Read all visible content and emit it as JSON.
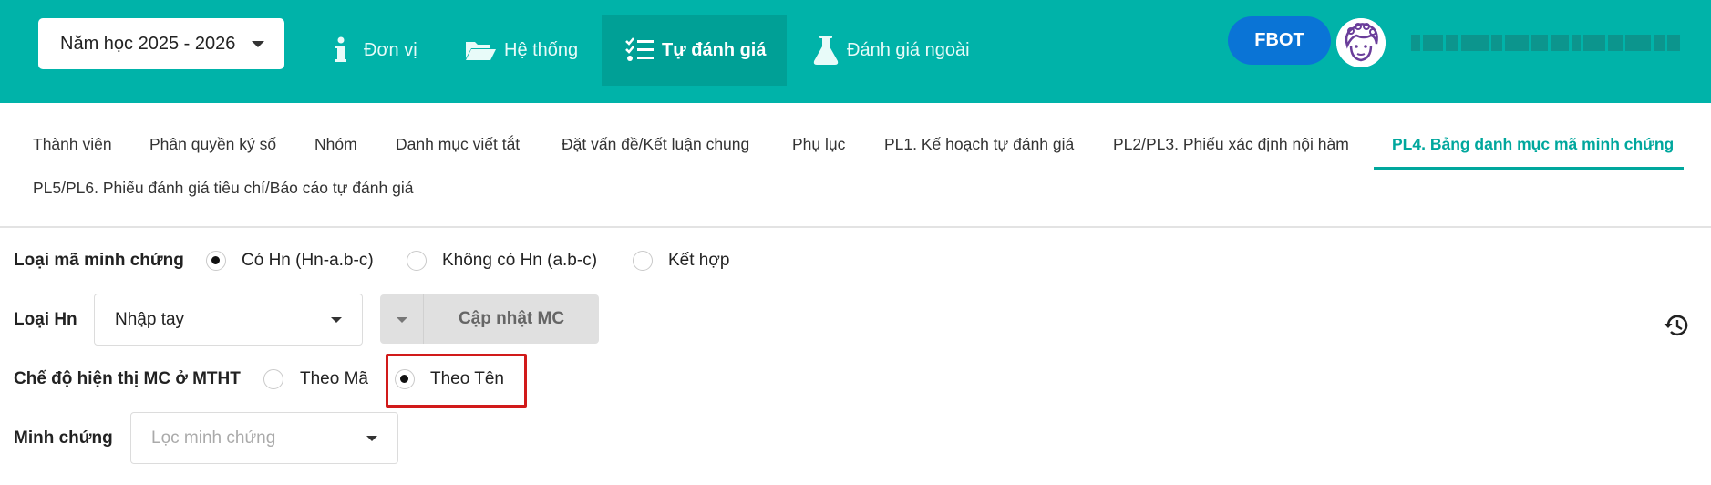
{
  "header": {
    "year_select": "Năm học 2025 - 2026",
    "nav": [
      {
        "label": "Đơn vị",
        "icon": "info-icon"
      },
      {
        "label": "Hệ thống",
        "icon": "folder-open-icon"
      },
      {
        "label": "Tự đánh giá",
        "icon": "checklist-icon"
      },
      {
        "label": "Đánh giá ngoài",
        "icon": "flask-icon"
      }
    ],
    "active_nav": "Tự đánh giá",
    "fbot_label": "FBOT",
    "colors": {
      "header_bg": "#00b3a9",
      "active_nav_bg": "#00a096",
      "fbot_bg": "#0a74d6"
    }
  },
  "tabs": [
    "Thành viên",
    "Phân quyền ký số",
    "Nhóm",
    "Danh mục viết tắt",
    "Đặt vấn đề/Kết luận chung",
    "Phụ lục",
    "PL1. Kế hoạch tự đánh giá",
    "PL2/PL3. Phiếu xác định nội hàm",
    "PL4. Bảng danh mục mã minh chứng",
    "PL5/PL6. Phiếu đánh giá tiêu chí/Báo cáo tự đánh giá"
  ],
  "active_tab": "PL4. Bảng danh mục mã minh chứng",
  "form": {
    "code_type": {
      "label": "Loại mã minh chứng",
      "options": [
        "Có Hn (Hn-a.b-c)",
        "Không có Hn (a.b-c)",
        "Kết hợp"
      ],
      "selected": "Có Hn (Hn-a.b-c)"
    },
    "hn_type": {
      "label": "Loại Hn",
      "value": "Nhập tay",
      "update_button": "Cập nhật MC"
    },
    "display_mode": {
      "label": "Chế độ hiện thị MC ở MTHT",
      "options": [
        "Theo Mã",
        "Theo Tên"
      ],
      "selected": "Theo Tên"
    },
    "evidence": {
      "label": "Minh chứng",
      "placeholder": "Lọc minh chứng"
    }
  },
  "accent_color": "#00a79d",
  "highlight_color": "#d11a1a"
}
